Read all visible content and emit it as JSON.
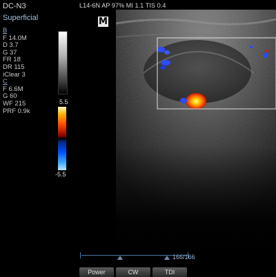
{
  "header": {
    "model": "DC-N3",
    "preset": "Superficial",
    "topbar": "L14-6N  AP 97%  MI 1.1 TIS 0.4"
  },
  "bmode": {
    "label": "B",
    "params": [
      "F 14.0M",
      "D 3.7",
      "G 37",
      "FR 18",
      "DR 115",
      "iClear 3"
    ]
  },
  "color": {
    "label": "C",
    "params": [
      "F 6.6M",
      "G 60",
      "WF 215",
      "PRF 0.9k"
    ],
    "scale_max": "5.5",
    "scale_min": "-5.5"
  },
  "logo": "M",
  "cine": {
    "frames": "166/166"
  },
  "softkeys": {
    "power": "Power",
    "cw": "CW",
    "tdi": "TDI"
  },
  "colors": {
    "doppler_hot": "#ff6a00",
    "doppler_cold": "#2a4cff",
    "roi_box": "#e0e0e0",
    "accent_text": "#9ec5e0"
  }
}
